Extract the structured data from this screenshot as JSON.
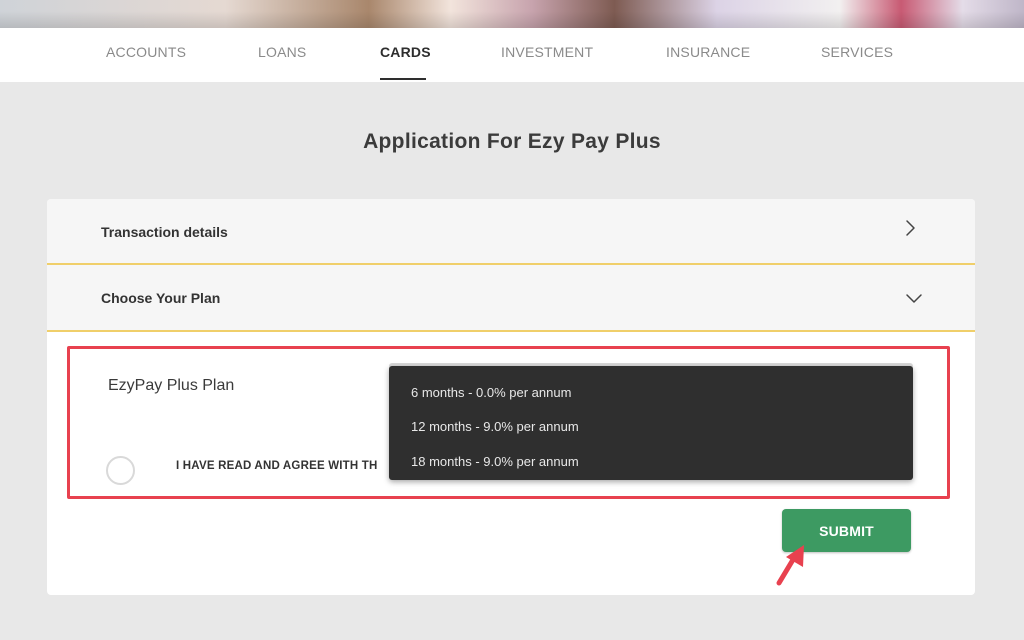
{
  "nav": {
    "items": [
      {
        "label": "ACCOUNTS",
        "active": false
      },
      {
        "label": "LOANS",
        "active": false
      },
      {
        "label": "CARDS",
        "active": true
      },
      {
        "label": "INVESTMENT",
        "active": false
      },
      {
        "label": "INSURANCE",
        "active": false
      },
      {
        "label": "SERVICES",
        "active": false
      }
    ]
  },
  "page": {
    "title": "Application For Ezy Pay Plus"
  },
  "accordion": {
    "transaction_details": {
      "label": "Transaction details",
      "icon": "chevron-right-icon"
    },
    "choose_plan": {
      "label": "Choose Your Plan",
      "icon": "chevron-down-icon"
    }
  },
  "plan": {
    "label": "EzyPay Plus Plan",
    "options": [
      "6 months - 0.0% per annum",
      "12 months - 9.0% per annum",
      "18 months - 9.0% per annum"
    ]
  },
  "agreement": {
    "text": "I HAVE READ AND AGREE WITH TH"
  },
  "actions": {
    "submit_label": "SUBMIT"
  },
  "colors": {
    "accent_green": "#3d9a62",
    "highlight_red": "#e8414f",
    "divider_gold": "#f0cf6a",
    "dropdown_bg": "#2f2f2f"
  }
}
